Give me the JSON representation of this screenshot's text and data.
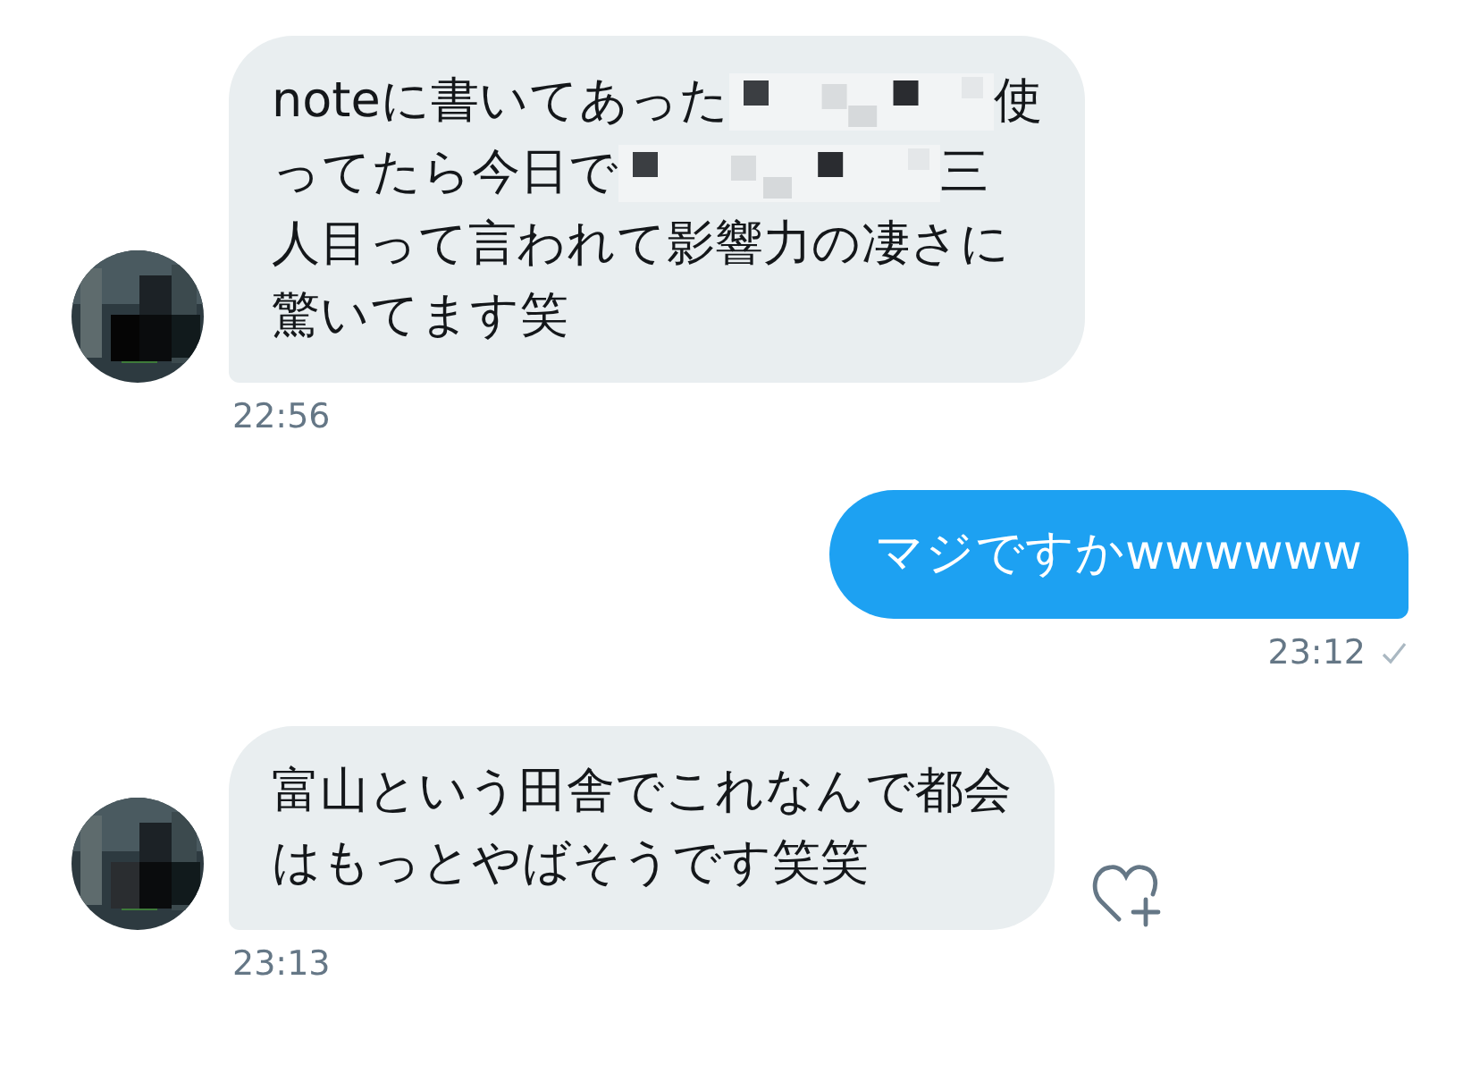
{
  "messages": [
    {
      "kind": "received",
      "lines": [
        [
          {
            "kind": "text",
            "text": "noteに書いてあった"
          },
          {
            "kind": "mosaic"
          },
          {
            "kind": "text",
            "text": "使"
          }
        ],
        [
          {
            "kind": "text",
            "text": "ってたら今日で"
          },
          {
            "kind": "mosaic"
          },
          {
            "kind": "text",
            "text": "三"
          }
        ],
        [
          {
            "kind": "text",
            "text": "人目って言われて影響力の凄さに"
          }
        ],
        [
          {
            "kind": "text",
            "text": "驚いてます笑"
          }
        ]
      ],
      "time": "22:56",
      "avatar": {
        "kind": "picture"
      }
    },
    {
      "kind": "sent",
      "lines": [
        [
          {
            "kind": "text",
            "text": "マジですかwwwwww"
          }
        ]
      ],
      "time": "23:12",
      "read": true
    },
    {
      "kind": "received",
      "lines": [
        [
          {
            "kind": "text",
            "text": "富山という田舎でこれなんで都会"
          }
        ],
        [
          {
            "kind": "text",
            "text": "はもっとやばそうです笑笑"
          }
        ]
      ],
      "time": "23:13",
      "avatar": {
        "kind": "picture"
      },
      "like_button": true
    }
  ]
}
